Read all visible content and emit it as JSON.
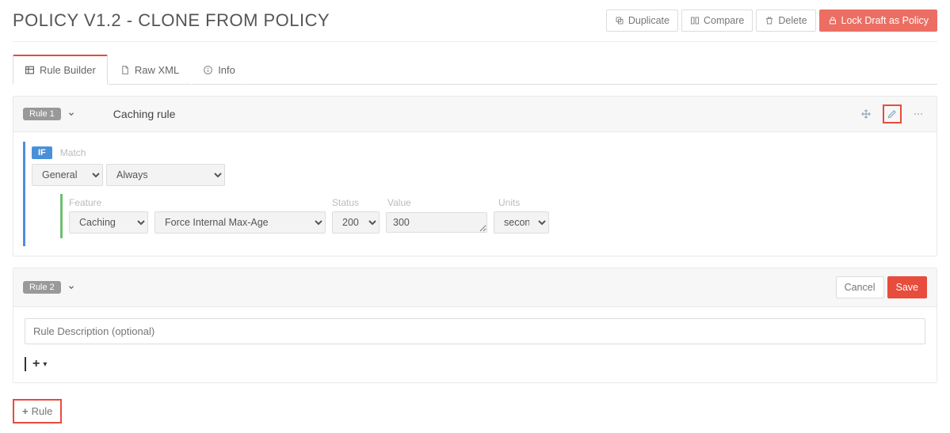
{
  "header": {
    "title": "POLICY V1.2 - CLONE FROM POLICY",
    "duplicate": "Duplicate",
    "compare": "Compare",
    "delete": "Delete",
    "lock": "Lock Draft as Policy"
  },
  "tabs": {
    "builder": "Rule Builder",
    "raw": "Raw XML",
    "info": "Info"
  },
  "rule1": {
    "badge": "Rule 1",
    "name": "Caching rule",
    "ifTag": "IF",
    "matchLabel": "Match",
    "categoryOptions": "General",
    "conditionOptions": "Always",
    "featureLabel": "Feature",
    "statusLabel": "Status",
    "valueLabel": "Value",
    "unitsLabel": "Units",
    "featureCategory": "Caching",
    "featureName": "Force Internal Max-Age",
    "status": "200",
    "value": "300",
    "units": "seconds"
  },
  "rule2": {
    "badge": "Rule 2",
    "cancel": "Cancel",
    "save": "Save",
    "descPlaceholder": "Rule Description (optional)"
  },
  "footer": {
    "addRule": "Rule"
  }
}
